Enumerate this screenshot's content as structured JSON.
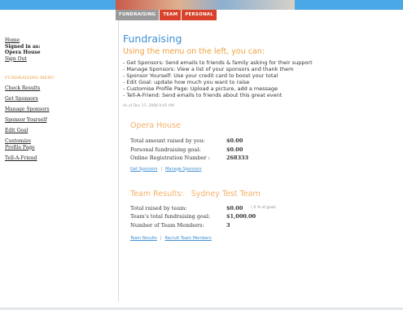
{
  "tabs": [
    "FUNDRAISING",
    "TEAM",
    "PERSONAL"
  ],
  "sidebar": {
    "home": "Home",
    "signed_in_label": "Signed in as:",
    "user_name": "Opera House",
    "sign_out": "Sign Out",
    "menu_header": "FUNDRAISING MENU",
    "menu": [
      "Check Results",
      "Get Sponsors",
      "Manage Sponsors",
      "Sponsor Yourself",
      "Edit Goal",
      "Customize Profile Page",
      "Tell-A-Friend"
    ]
  },
  "main": {
    "title": "Fundraising",
    "subtitle": "Using the menu on the left, you can:",
    "bullets": [
      "- Get Sponsors: Send emails to friends & family asking for their support",
      "- Manage Sponsors: View a list of your sponsors and thank them",
      "- Sponsor Yourself: Use your credit card to boost your total",
      "- Edit Goal: update how much you want to raise",
      "- Customise Profile Page: Upload a picture, add a message",
      "- Tell-A-Friend: Send emails to friends about this great event"
    ],
    "as_of": "As of Dec 17, 2008 9:45 AM",
    "personal": {
      "title": "Opera House",
      "rows": [
        {
          "label": "Total amount raised by you:",
          "value": "$0.00"
        },
        {
          "label": "Personal fundraising goal:",
          "value": "$0.00"
        },
        {
          "label": "Online Registration Number :",
          "value": "268333"
        }
      ],
      "link1": "Get Sponsors",
      "link2": "Manage Sponsors",
      "sep": "|"
    },
    "team": {
      "title": "Team Results:   Sydney Test Team",
      "rows": [
        {
          "label": "Total raised by team:",
          "value": "$0.00",
          "note": "( 0 % of goal)"
        },
        {
          "label": "Team's total fundraising goal:",
          "value": "$1,000.00"
        },
        {
          "label": "Number of Team Members:",
          "value": "3"
        }
      ],
      "link1": "Team Results",
      "link2": "Recruit Team Members",
      "sep": "|"
    }
  }
}
